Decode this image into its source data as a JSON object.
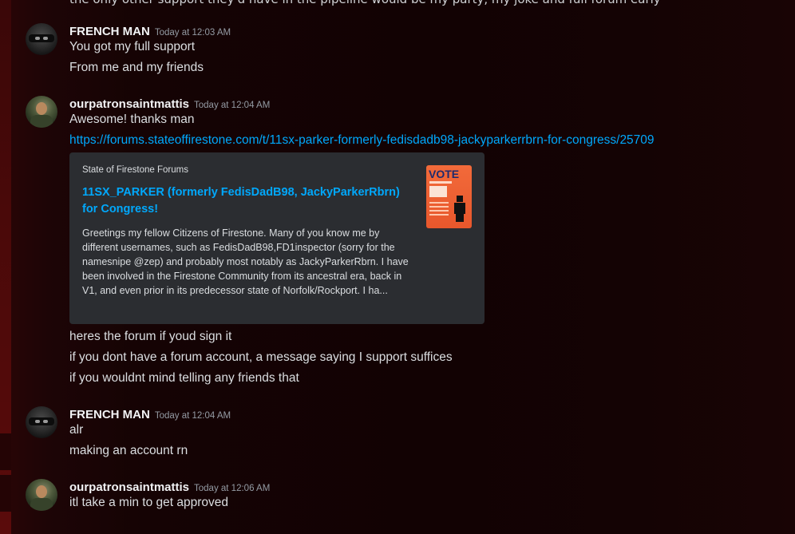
{
  "top_partial_text": "the only other support they'd have in the pipeline would be my party, my joke and full forum early",
  "messages": [
    {
      "username": "FRENCH MAN",
      "timestamp": "Today at 12:03 AM",
      "avatar_icon": "masked-avatar-icon",
      "lines": [
        "You got my full support",
        "From me and my friends"
      ]
    },
    {
      "username": "ourpatronsaintmattis",
      "timestamp": "Today at 12:04 AM",
      "avatar_icon": "soldier-avatar-icon",
      "lines": [
        "Awesome! thanks man"
      ],
      "link": "https://forums.stateoffirestone.com/t/11sx-parker-formerly-fedisdadb98-jackyparkerrbrn-for-congress/25709",
      "embed": {
        "provider": "State of Firestone Forums",
        "title": "11SX_PARKER (formerly FedisDadB98, JackyParkerRbrn) for Congress!",
        "description": "Greetings my fellow Citizens of Firestone. Many of you know me by different usernames, such as FedisDadB98,FD1inspector (sorry for the namesnipe @zep) and probably most notably as JackyParkerRbrn. I have been involved in the Firestone Community from its ancestral era, back in V1, and even prior in its predecessor state of Norfolk/Rockport. I ha...",
        "thumbnail_label": "VOTE",
        "thumbnail_icon": "campaign-poster-icon"
      },
      "after_lines": [
        "heres the forum if youd sign it",
        "if you dont have a forum account, a message saying I support suffices",
        "if you wouldnt mind telling any friends that"
      ]
    },
    {
      "username": "FRENCH MAN",
      "timestamp": "Today at 12:04 AM",
      "avatar_icon": "masked-avatar-icon",
      "lines": [
        "alr",
        "making an account rn"
      ]
    },
    {
      "username": "ourpatronsaintmattis",
      "timestamp": "Today at 12:06 AM",
      "avatar_icon": "soldier-avatar-icon",
      "lines": [
        "itl take a min to get approved"
      ]
    }
  ],
  "colors": {
    "background": "#120203",
    "link": "#00a8fc",
    "embed_bg": "#2b2d31",
    "username": "#f2f3f5",
    "timestamp": "#949ba4",
    "text": "#dbdee1"
  }
}
